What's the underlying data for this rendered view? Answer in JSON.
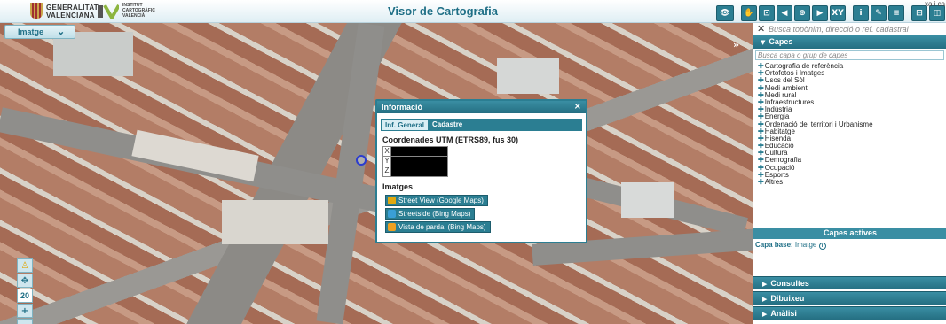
{
  "header": {
    "gv_line1": "GENERALITAT",
    "gv_line2": "VALENCIANA",
    "icv_line1": "INSTITUT",
    "icv_line2": "CARTOGRÀFIC",
    "icv_line3": "VALENCIÀ",
    "title": "Visor de Cartografia",
    "cut_text": "xa i ca",
    "toolbar_icons": [
      "eye-icon",
      "hand-pan-icon",
      "zoom-extent-icon",
      "prev-view-icon",
      "zoom-box-icon",
      "next-view-icon",
      "xy-coordinates-icon",
      "info-icon",
      "measure-icon",
      "print-icon",
      "share-icon",
      "window-icon",
      "camera-icon"
    ],
    "toolbar_glyphs": [
      "👁",
      "✋",
      "⊡",
      "◀",
      "⊕",
      "▶",
      "XY",
      "i",
      "✎",
      "≡",
      "⊟",
      "◫",
      "◎"
    ]
  },
  "layer_selector": {
    "label": "Imatge",
    "chevron": "⌄"
  },
  "zoom": {
    "pegman": "♙",
    "pan": "✥",
    "level": "20",
    "plus": "+",
    "minus": "−"
  },
  "popup": {
    "title": "Informació",
    "close": "×",
    "tabs": [
      "Inf. General",
      "Cadastre"
    ],
    "coord_title": "Coordenades UTM (ETRS89, fus 30)",
    "coord_keys": [
      "X",
      "Y",
      "Z"
    ],
    "images_title": "Imatges",
    "buttons": [
      {
        "label": "Street View (Google Maps)",
        "color": "#e0a810"
      },
      {
        "label": "Streetside (Bing Maps)",
        "color": "#3a9fd6"
      },
      {
        "label": "Vista de pardal (Bing Maps)",
        "color": "#f0a020"
      }
    ]
  },
  "panel": {
    "search_placeholder": "Busca topònim, direcció o ref. cadastral",
    "capes_title": "Capes",
    "layer_search_placeholder": "Busca capa o grup de capes",
    "layers": [
      "Cartografia de referència",
      "Ortofotos i Imatges",
      "Usos del Sòl",
      "Medi ambient",
      "Medi rural",
      "Infraestructures",
      "Indústria",
      "Energia",
      "Ordenació del territori i Urbanisme",
      "Habitatge",
      "Hisenda",
      "Educació",
      "Cultura",
      "Demografia",
      "Ocupació",
      "Esports",
      "Altres"
    ],
    "active_title": "Capes actives",
    "capa_base_label": "Capa base:",
    "capa_base_value": "Imatge",
    "accordions": [
      "Consultes",
      "Dibuixeu",
      "Anàlisi"
    ]
  },
  "colors": {
    "accent": "#2b7e92",
    "title": "#1f6f86"
  }
}
